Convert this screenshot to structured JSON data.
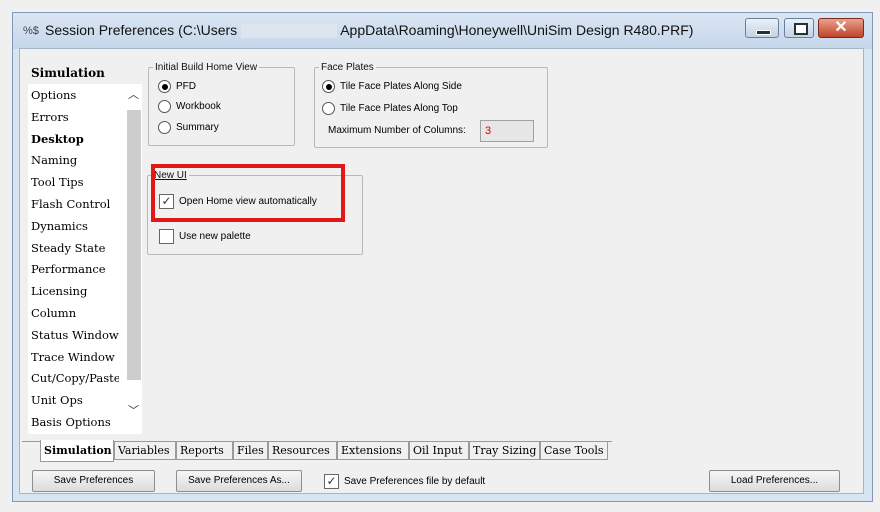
{
  "window": {
    "title_prefix": "Session Preferences (C:\\Users",
    "title_suffix": "AppData\\Roaming\\Honeywell\\UniSim Design R480.PRF)",
    "app_icon": "%$"
  },
  "sidebar": {
    "header": "Simulation",
    "items": [
      {
        "label": "Options",
        "bold": false
      },
      {
        "label": "Errors",
        "bold": false
      },
      {
        "label": "Desktop",
        "bold": true
      },
      {
        "label": "Naming",
        "bold": false
      },
      {
        "label": "Tool Tips",
        "bold": false
      },
      {
        "label": "Flash Control",
        "bold": false
      },
      {
        "label": "Dynamics",
        "bold": false
      },
      {
        "label": "Steady State",
        "bold": false
      },
      {
        "label": "Performance",
        "bold": false
      },
      {
        "label": "Licensing",
        "bold": false
      },
      {
        "label": "Column",
        "bold": false
      },
      {
        "label": "Status Window",
        "bold": false
      },
      {
        "label": "Trace Window",
        "bold": false
      },
      {
        "label": "Cut/Copy/Paste",
        "bold": false
      },
      {
        "label": "Unit Ops",
        "bold": false
      },
      {
        "label": "Basis Options",
        "bold": false
      }
    ]
  },
  "initial_build": {
    "legend": "Initial Build Home View",
    "options": [
      {
        "label": "PFD",
        "selected": true
      },
      {
        "label": "Workbook",
        "selected": false
      },
      {
        "label": "Summary",
        "selected": false
      }
    ]
  },
  "face_plates": {
    "legend": "Face Plates",
    "options": [
      {
        "label": "Tile Face Plates Along Side",
        "selected": true
      },
      {
        "label": "Tile Face Plates Along Top",
        "selected": false
      }
    ],
    "max_columns_label": "Maximum Number of Columns:",
    "max_columns_value": "3"
  },
  "new_ui": {
    "legend": "New UI",
    "open_home_label": "Open Home view automatically",
    "open_home_checked": true,
    "palette_label": "Use new palette",
    "palette_checked": false
  },
  "tabs": [
    {
      "label": "Simulation",
      "active": true
    },
    {
      "label": "Variables",
      "active": false
    },
    {
      "label": "Reports",
      "active": false
    },
    {
      "label": "Files",
      "active": false
    },
    {
      "label": "Resources",
      "active": false
    },
    {
      "label": "Extensions",
      "active": false
    },
    {
      "label": "Oil Input",
      "active": false
    },
    {
      "label": "Tray Sizing",
      "active": false
    },
    {
      "label": "Case Tools",
      "active": false
    }
  ],
  "footer": {
    "save_label": "Save Preferences",
    "save_as_label": "Save Preferences As...",
    "default_label": "Save Preferences file by default",
    "default_checked": true,
    "load_label": "Load Preferences..."
  },
  "colors": {
    "highlight": "#e01818"
  }
}
